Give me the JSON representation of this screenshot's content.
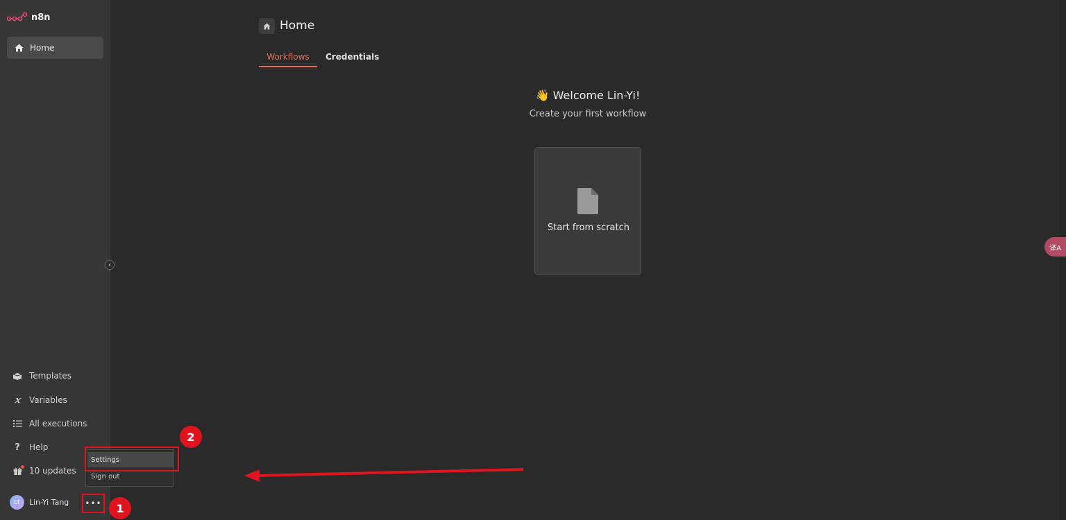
{
  "app": {
    "logo_text": "n8n"
  },
  "sidebar": {
    "home_label": "Home",
    "bottom_items": [
      {
        "label": "Templates",
        "icon": "box-open-icon"
      },
      {
        "label": "Variables",
        "icon": "variable-x-icon"
      },
      {
        "label": "All executions",
        "icon": "tasks-list-icon"
      },
      {
        "label": "Help",
        "icon": "question-icon"
      },
      {
        "label": "10 updates",
        "icon": "gift-icon"
      }
    ],
    "user": {
      "initials": "LT",
      "name": "Lin-Yi Tang"
    },
    "more_label": "•••",
    "collapse_glyph": "‹"
  },
  "user_menu": {
    "items": [
      {
        "label": "Settings"
      },
      {
        "label": "Sign out"
      }
    ]
  },
  "main": {
    "title": "Home",
    "tabs": [
      {
        "label": "Workflows",
        "active": true
      },
      {
        "label": "Credentials",
        "active": false
      }
    ],
    "welcome": "👋 Welcome Lin-Yi!",
    "subtitle": "Create your first workflow",
    "card_label": "Start from scratch"
  },
  "annotations": {
    "badge_1": "1",
    "badge_2": "2"
  },
  "translate_button": "译A",
  "colors": {
    "accent": "#ea6a53",
    "annotation": "#e0141e",
    "sidebar_bg": "#363636",
    "main_bg": "#2a2a2a"
  }
}
